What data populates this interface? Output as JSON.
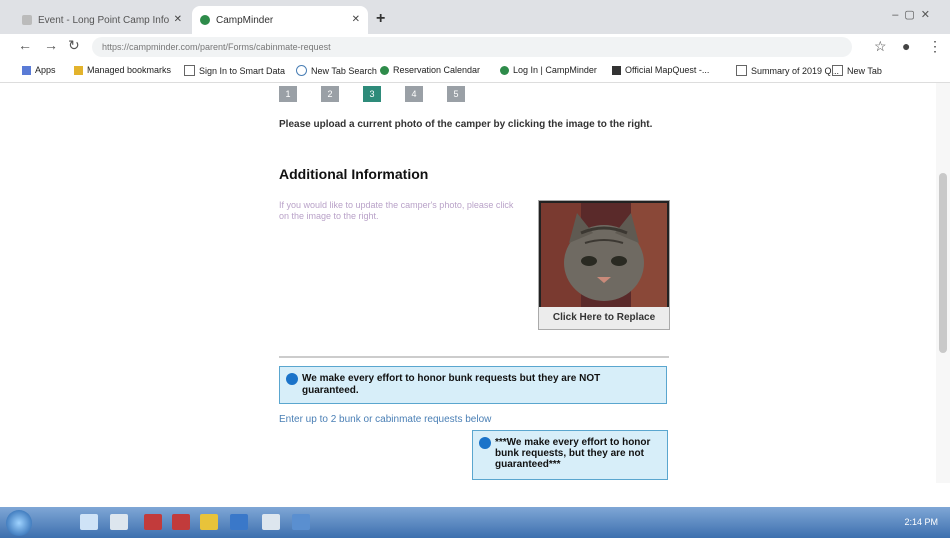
{
  "browser": {
    "tabs": [
      {
        "label": "Event - Long Point Camp Info",
        "active": false
      },
      {
        "label": "CampMinder",
        "active": true
      }
    ],
    "url": "https://campminder.com/parent/Forms/cabinmate-request",
    "bookmarks": [
      "Apps",
      "Managed bookmarks",
      "Sign In to Smart Data",
      "New Tab Search",
      "Reservation Calendar",
      "Log In | CampMinder",
      "Official MapQuest -...",
      "Summary of 2019 Q...",
      "New Tab"
    ]
  },
  "page": {
    "photo_steps": [
      "1",
      "2",
      "3",
      "4",
      "5"
    ],
    "active_step": 2,
    "upload_note": "Please upload a current photo of the camper by clicking the image to the right.",
    "section_title": "Additional Information",
    "photo_note": "If you would like to update the camper's photo, please click on the image to the right.",
    "photo_caption": "Click Here to Replace",
    "notice_text": "We make every effort to honor bunk requests but they are NOT guaranteed.",
    "bunk_label": "Enter up to 2 bunk or cabinmate requests below",
    "notice2_text": "***We make every effort to honor bunk requests, but they are not guaranteed***"
  },
  "taskbar": {
    "clock": "2:14 PM"
  },
  "colors": {
    "accent": "#2e8b7a",
    "notice_bg": "#d7eef9",
    "notice_border": "#5aa6cf",
    "link": "#4a7fb5"
  }
}
